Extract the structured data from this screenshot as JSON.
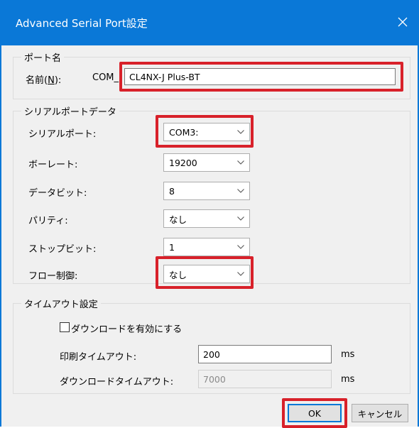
{
  "window": {
    "title": "Advanced Serial Port設定",
    "close_icon": "close-icon"
  },
  "port_name": {
    "group_title": "ポート名",
    "name_label_prefix": "名前(",
    "name_label_accel": "N",
    "name_label_suffix": "):",
    "com_prefix": "COM_",
    "name_value": "CL4NX-J Plus-BT"
  },
  "serial": {
    "group_title": "シリアルポートデータ",
    "rows": [
      {
        "label": "シリアルポート:",
        "value": "COM3:"
      },
      {
        "label": "ボーレート:",
        "value": "19200"
      },
      {
        "label": "データビット:",
        "value": "8"
      },
      {
        "label": "パリティ:",
        "value": "なし"
      },
      {
        "label": "ストップビット:",
        "value": "1"
      },
      {
        "label": "フロー制御:",
        "value": "なし"
      }
    ]
  },
  "timeout": {
    "group_title": "タイムアウト設定",
    "download_checkbox_label": "ダウンロードを有効にする",
    "download_enabled": false,
    "print_label": "印刷タイムアウト:",
    "print_value": "200",
    "print_unit": "ms",
    "download_label": "ダウンロードタイムアウト:",
    "download_value": "7000",
    "download_unit": "ms"
  },
  "buttons": {
    "ok": "OK",
    "cancel": "キャンセル"
  },
  "colors": {
    "titlebar": "#0a78d7",
    "highlight": "#d8212a",
    "dialog_bg": "#f0f0f0"
  }
}
